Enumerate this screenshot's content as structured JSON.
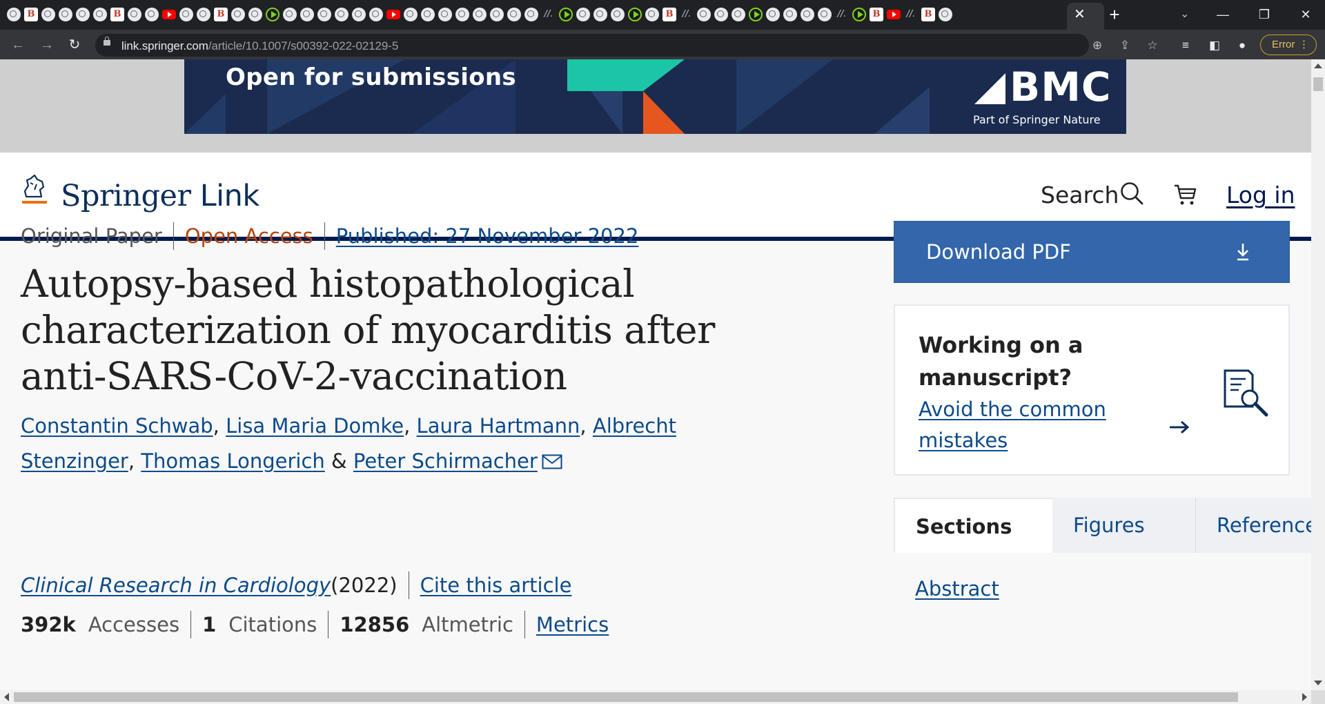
{
  "browser": {
    "url_domain": "link.springer.com",
    "url_path": "/article/10.1007/s00392-022-02129-5",
    "tab_close_label": "✕",
    "new_tab_label": "+",
    "profile_status": "Error",
    "tab_favicons": [
      "globe",
      "red",
      "globe",
      "globe",
      "globe",
      "globe",
      "red",
      "globe",
      "globe",
      "yt",
      "globe",
      "globe",
      "red",
      "globe",
      "globe",
      "play",
      "globe",
      "globe",
      "globe",
      "globe",
      "globe",
      "globe",
      "yt",
      "globe",
      "globe",
      "globe",
      "globe",
      "globe",
      "globe",
      "globe",
      "globe",
      "slash",
      "play",
      "globe",
      "globe",
      "globe",
      "play",
      "globe",
      "red",
      "slash",
      "globe",
      "globe",
      "globe",
      "play",
      "globe",
      "globe",
      "globe",
      "globe",
      "slash",
      "play",
      "red",
      "yt",
      "slash",
      "red",
      "globe"
    ]
  },
  "ad": {
    "title": "Open for submissions",
    "brand": "BMC",
    "brand_sub": "Part of Springer Nature",
    "colors": {
      "background": "#1a2b4f",
      "teal": "#1bc5a5",
      "orange": "#e5571f"
    }
  },
  "header": {
    "logo_springer": "Springer",
    "logo_link": "Link",
    "search_label": "Search",
    "login_label": "Log in"
  },
  "article": {
    "type": "Original Paper",
    "access": "Open Access",
    "published": "Published: 27 November 2022",
    "title": "Autopsy-based histopathological characterization of myocarditis after anti-SARS-CoV-2-vaccination",
    "authors": [
      "Constantin Schwab",
      "Lisa Maria Domke",
      "Laura Hartmann",
      "Albrecht Stenzinger",
      "Thomas Longerich",
      "Peter Schirmacher"
    ],
    "author_sep": ", ",
    "author_and": " & ",
    "journal": "Clinical Research in Cardiology",
    "year": " (2022)",
    "cite_label": "Cite this article",
    "metrics": {
      "accesses_value": "392k",
      "accesses_label": "Accesses",
      "citations_value": "1",
      "citations_label": "Citations",
      "altmetric_value": "12856",
      "altmetric_label": "Altmetric",
      "link_label": "Metrics"
    }
  },
  "sidebar": {
    "download_label": "Download PDF",
    "manuscript_heading": "Working on a manuscript?",
    "manuscript_link": "Avoid the common mistakes",
    "tabs": [
      "Sections",
      "Figures",
      "References"
    ],
    "first_section_link": "Abstract"
  },
  "colors": {
    "brand_navy": "#001a4d",
    "link_blue": "#0c4a8a",
    "download_blue": "#3366aa",
    "open_access_orange": "#b5430e"
  }
}
